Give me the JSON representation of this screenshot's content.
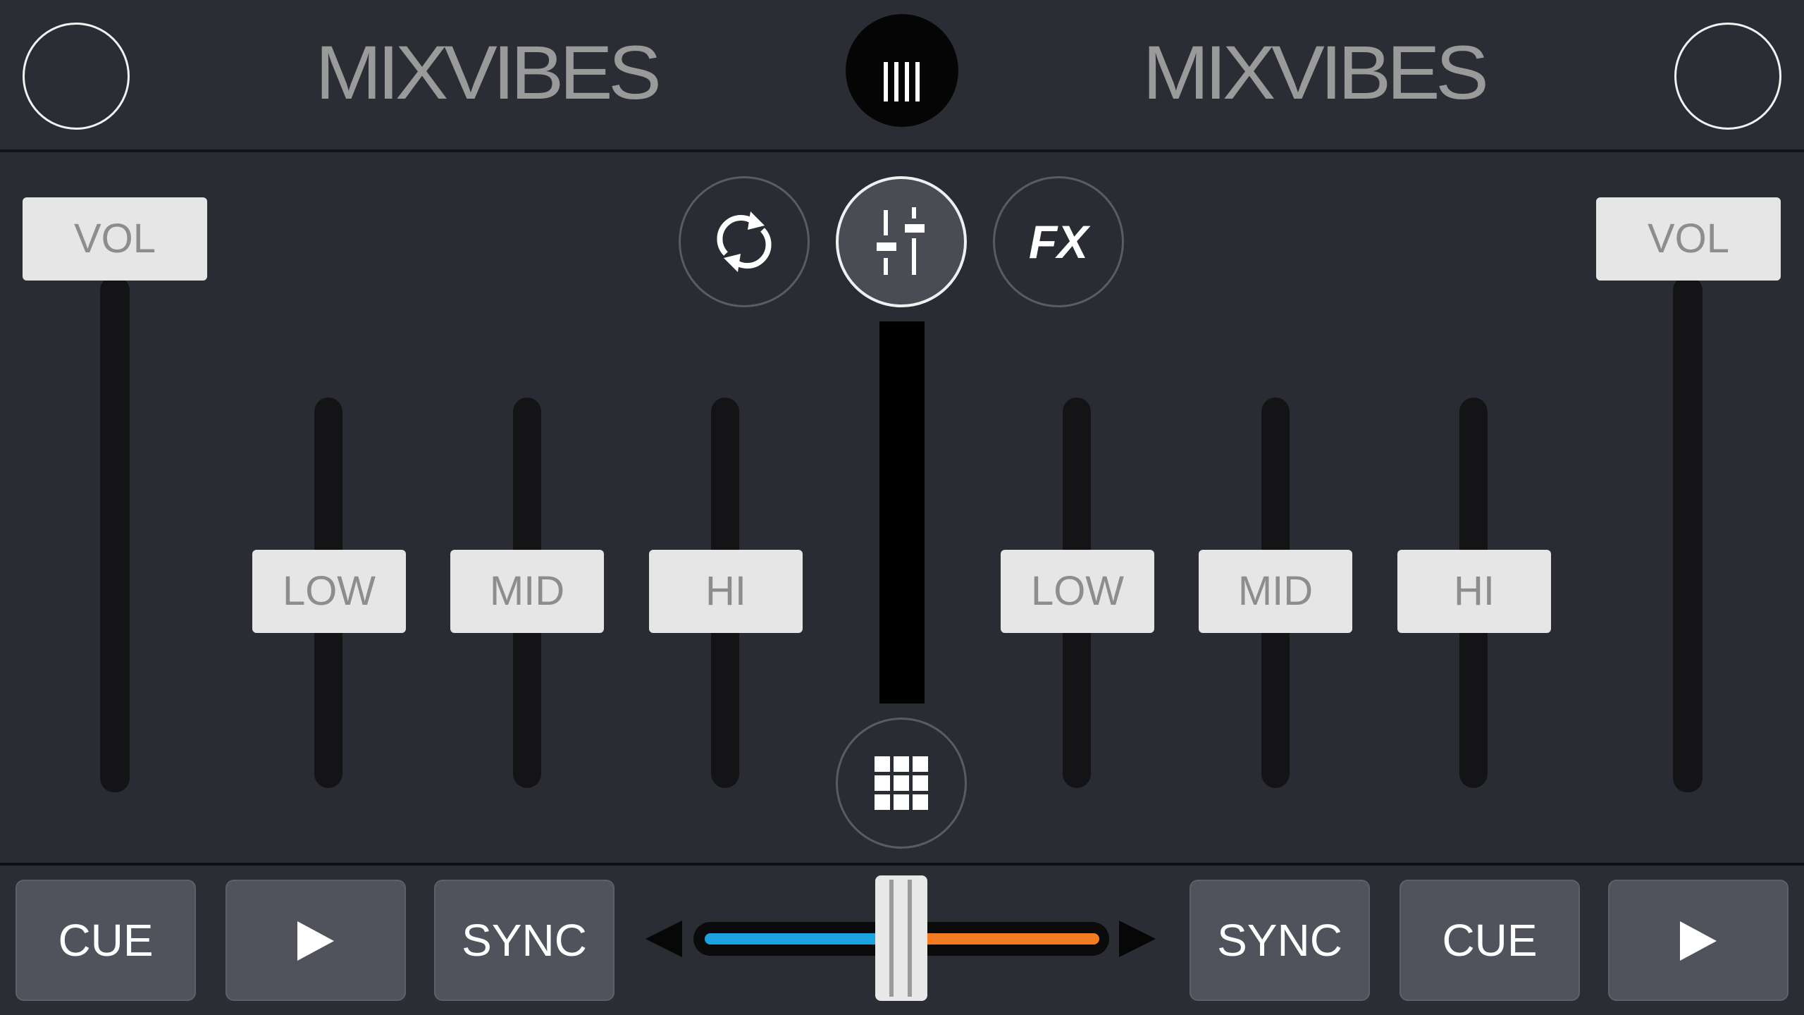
{
  "header": {
    "logo_left": "MIXVIBES",
    "logo_right": "MIXVIBES",
    "menu_icon": "library-bars-icon"
  },
  "mixer": {
    "left": {
      "vol_label": "VOL",
      "low_label": "LOW",
      "mid_label": "MID",
      "hi_label": "HI"
    },
    "right": {
      "vol_label": "VOL",
      "low_label": "LOW",
      "mid_label": "MID",
      "hi_label": "HI"
    },
    "mode_buttons": {
      "sync_icon": "loop-icon",
      "mixer_icon": "mixer-sliders-icon",
      "fx_label": "FX",
      "sampler_icon": "grid-icon"
    }
  },
  "bottom": {
    "left": {
      "cue_label": "CUE",
      "play_icon": "play-icon",
      "sync_label": "SYNC"
    },
    "right": {
      "sync_label": "SYNC",
      "cue_label": "CUE",
      "play_icon": "play-icon"
    },
    "crossfader": {
      "left_color": "#1aa3df",
      "right_color": "#f47c20"
    }
  },
  "colors": {
    "background": "#2a2c33",
    "handle": "#e6e6e6",
    "handle_text": "#8d8d8d",
    "pad": "#50535c"
  }
}
